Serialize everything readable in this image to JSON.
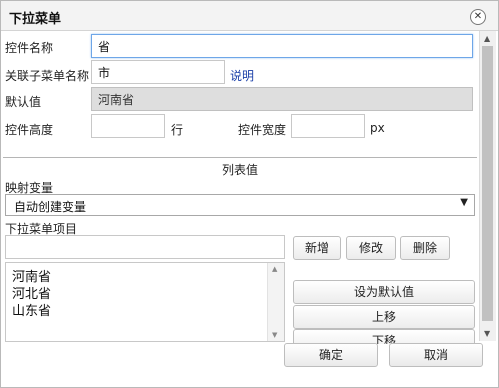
{
  "dialog": {
    "title": "下拉菜单",
    "close_glyph": "✕"
  },
  "form": {
    "control_name_label": "控件名称",
    "control_name_value": "省",
    "sub_menu_label": "关联子菜单名称",
    "sub_menu_value": "市",
    "explain_link": "说明",
    "default_label": "默认值",
    "default_value": "河南省",
    "height_label": "控件高度",
    "height_value": "",
    "height_unit": "行",
    "width_label": "控件宽度",
    "width_value": "",
    "width_unit": "px"
  },
  "list_section": {
    "heading": "列表值",
    "mapping_label": "映射变量",
    "mapping_selected": "自动创建变量",
    "items_label": "下拉菜单项目",
    "new_item_value": "",
    "add_button": "新增",
    "edit_button": "修改",
    "delete_button": "删除",
    "items": [
      "河南省",
      "河北省",
      "山东省"
    ],
    "set_default_button": "设为默认值",
    "move_up_button": "上移",
    "move_down_button": "下移"
  },
  "footer": {
    "ok_button": "确定",
    "cancel_button": "取消"
  },
  "icons": {
    "close": "close-icon",
    "select_arrow": "chevron-down-icon",
    "scroll_up": "scroll-up-icon",
    "scroll_down": "scroll-down-icon"
  }
}
